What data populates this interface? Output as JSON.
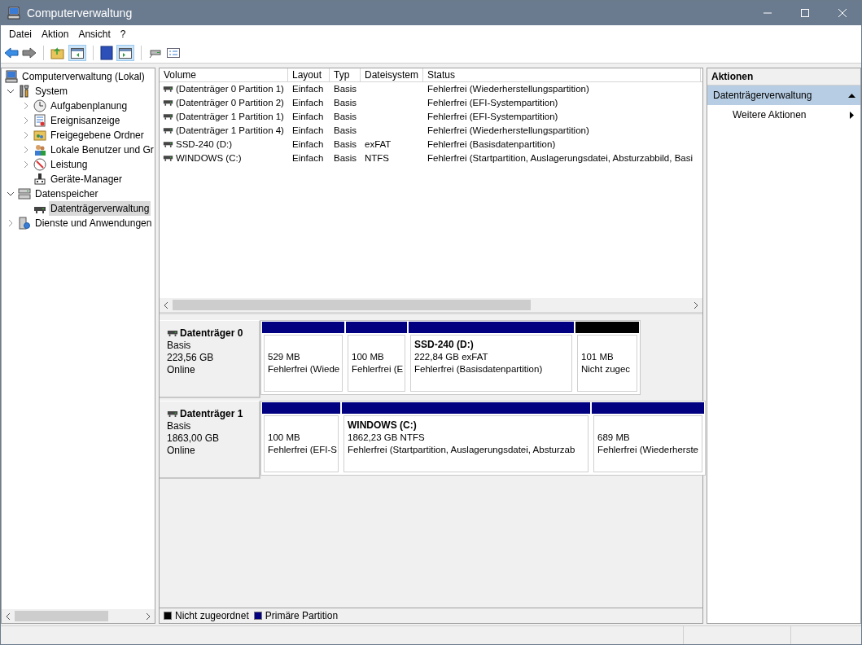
{
  "window": {
    "title": "Computerverwaltung"
  },
  "menu": [
    "Datei",
    "Aktion",
    "Ansicht",
    "?"
  ],
  "tree": [
    {
      "label": "Computerverwaltung (Lokal)",
      "selected": false,
      "children": [
        {
          "label": "System",
          "expanded": true,
          "selected": false,
          "children": [
            {
              "label": "Aufgabenplanung",
              "expanded": false,
              "selected": false
            },
            {
              "label": "Ereignisanzeige",
              "expanded": false,
              "selected": false
            },
            {
              "label": "Freigegebene Ordner",
              "expanded": false,
              "selected": false
            },
            {
              "label": "Lokale Benutzer und Gr",
              "expanded": false,
              "selected": false
            },
            {
              "label": "Leistung",
              "expanded": false,
              "selected": false
            },
            {
              "label": "Geräte-Manager",
              "selected": false
            }
          ]
        },
        {
          "label": "Datenspeicher",
          "expanded": true,
          "selected": false,
          "children": [
            {
              "label": "Datenträgerverwaltung",
              "selected": true
            }
          ]
        },
        {
          "label": "Dienste und Anwendungen",
          "expanded": false,
          "selected": false
        }
      ]
    }
  ],
  "table": {
    "columns": [
      "Volume",
      "Layout",
      "Typ",
      "Dateisystem",
      "Status"
    ],
    "rows": [
      [
        "(Datenträger 0 Partition 1)",
        "Einfach",
        "Basis",
        "",
        "Fehlerfrei (Wiederherstellungspartition)"
      ],
      [
        "(Datenträger 0 Partition 2)",
        "Einfach",
        "Basis",
        "",
        "Fehlerfrei (EFI-Systempartition)"
      ],
      [
        "(Datenträger 1 Partition 1)",
        "Einfach",
        "Basis",
        "",
        "Fehlerfrei (EFI-Systempartition)"
      ],
      [
        "(Datenträger 1 Partition 4)",
        "Einfach",
        "Basis",
        "",
        "Fehlerfrei (Wiederherstellungspartition)"
      ],
      [
        "SSD-240 (D:)",
        "Einfach",
        "Basis",
        "exFAT",
        "Fehlerfrei (Basisdatenpartition)"
      ],
      [
        "WINDOWS (C:)",
        "Einfach",
        "Basis",
        "NTFS",
        "Fehlerfrei (Startpartition, Auslagerungsdatei, Absturzabbild, Basi"
      ]
    ]
  },
  "disks": [
    {
      "name": "Datenträger 0",
      "type": "Basis",
      "size": "223,56 GB",
      "state": "Online",
      "partitions": [
        {
          "kind": "primary",
          "size": "529 MB",
          "status": "Fehlerfrei (Wiede"
        },
        {
          "kind": "primary",
          "size": "100 MB",
          "status": "Fehlerfrei (E"
        },
        {
          "kind": "primary",
          "name": "SSD-240  (D:)",
          "size": "222,84 GB exFAT",
          "status": "Fehlerfrei (Basisdatenpartition)"
        },
        {
          "kind": "unallocated",
          "size": "101 MB",
          "status": "Nicht zugec"
        }
      ]
    },
    {
      "name": "Datenträger 1",
      "type": "Basis",
      "size": "1863,00 GB",
      "state": "Online",
      "partitions": [
        {
          "kind": "primary",
          "size": "100 MB",
          "status": "Fehlerfrei (EFI-S"
        },
        {
          "kind": "primary",
          "name": "WINDOWS  (C:)",
          "size": "1862,23 GB NTFS",
          "status": "Fehlerfrei (Startpartition, Auslagerungsdatei, Absturzab"
        },
        {
          "kind": "primary",
          "size": "689 MB",
          "status": "Fehlerfrei (Wiederherste"
        }
      ]
    }
  ],
  "legend": [
    {
      "label": "Nicht zugeordnet",
      "color": "#000000"
    },
    {
      "label": "Primäre Partition",
      "color": "#000080"
    }
  ],
  "actions": {
    "title": "Aktionen",
    "items": [
      {
        "label": "Datenträgerverwaltung",
        "kind": "header",
        "selected": true
      },
      {
        "label": "Weitere Aktionen",
        "kind": "submenu",
        "selected": false
      }
    ]
  }
}
